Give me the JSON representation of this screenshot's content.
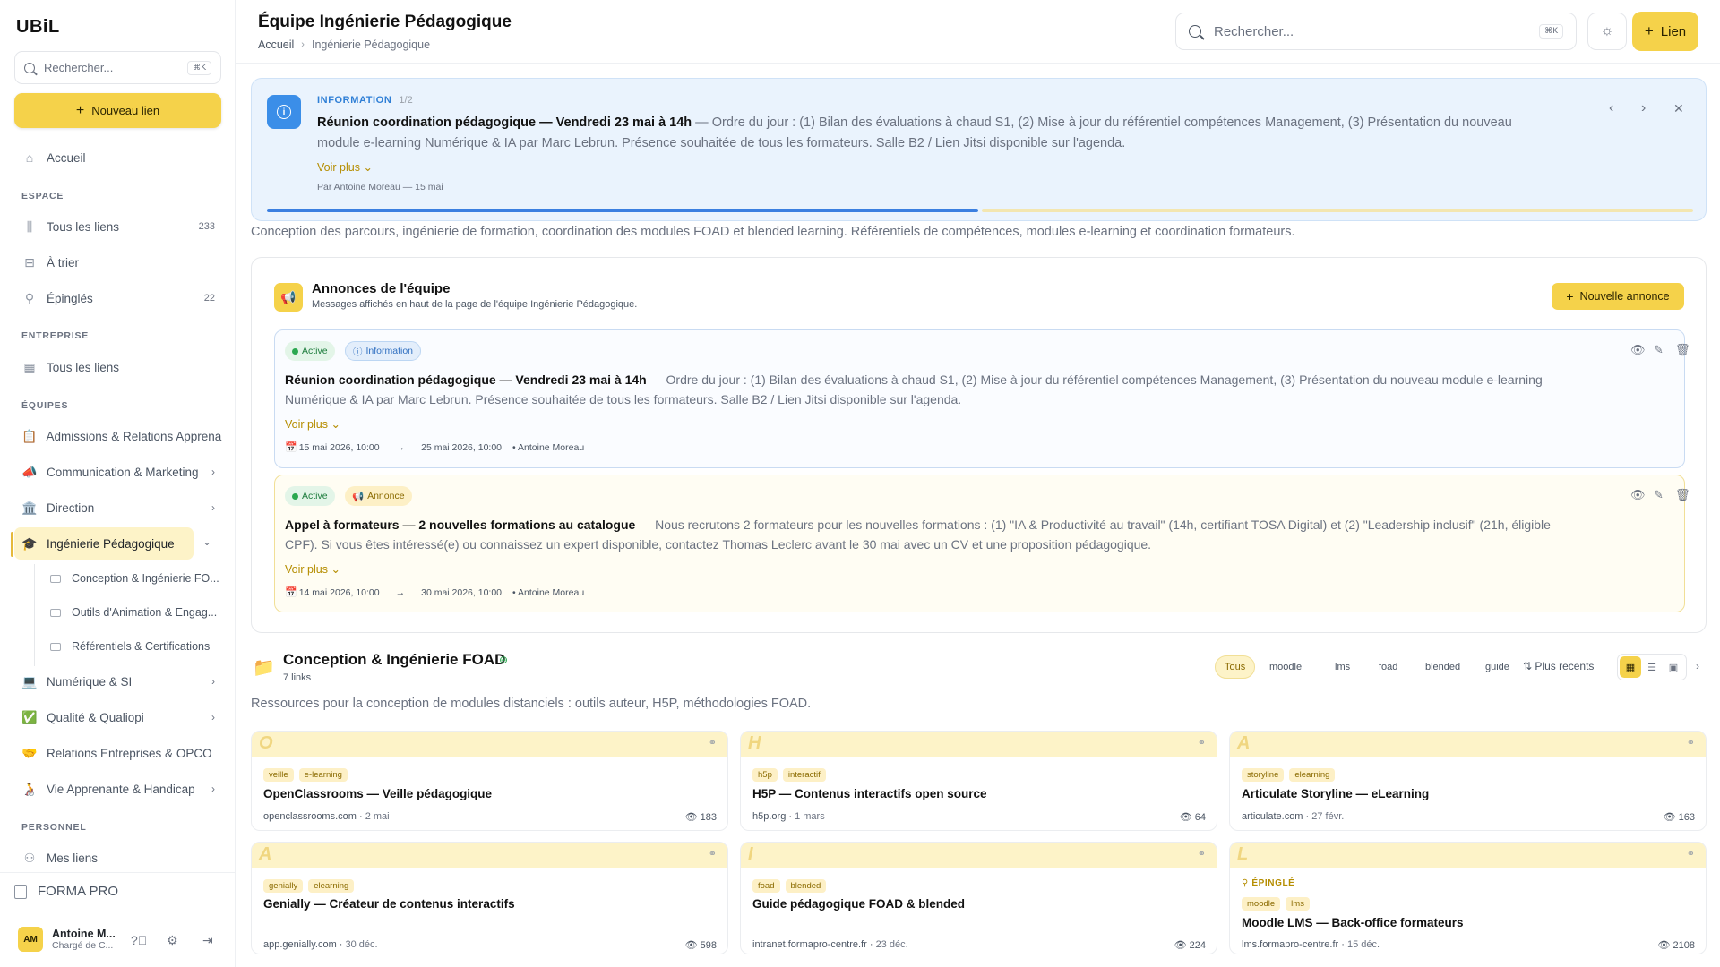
{
  "app": {
    "logo": "UBiL"
  },
  "sidebar": {
    "search_placeholder": "Rechercher...",
    "search_kbd": "⌘K",
    "new_link": "Nouveau lien",
    "home": "Accueil",
    "section_espace": "ESPACE",
    "all_links": "Tous les liens",
    "all_links_count": "233",
    "to_sort": "À trier",
    "pinned": "Épinglés",
    "pinned_count": "22",
    "section_entreprise": "ENTREPRISE",
    "ent_all_links": "Tous les liens",
    "section_equipes": "ÉQUIPES",
    "teams": [
      {
        "icon": "📋",
        "label": "Admissions & Relations Apprenants"
      },
      {
        "icon": "📣",
        "label": "Communication & Marketing"
      },
      {
        "icon": "🏛️",
        "label": "Direction"
      },
      {
        "icon": "🎓",
        "label": "Ingénierie Pédagogique"
      }
    ],
    "sub_items": [
      "Conception & Ingénierie FO...",
      "Outils d'Animation & Engag...",
      "Référentiels & Certifications"
    ],
    "teams2": [
      {
        "icon": "💻",
        "label": "Numérique & SI"
      },
      {
        "icon": "✅",
        "label": "Qualité & Qualiopi"
      },
      {
        "icon": "🤝",
        "label": "Relations Entreprises & OPCO"
      },
      {
        "icon": "🧑‍🦽",
        "label": "Vie Apprenante & Handicap"
      }
    ],
    "section_personnel": "PERSONNEL",
    "my_links": "Mes liens",
    "org_name": "FORMA PRO",
    "user": {
      "initials": "AM",
      "name": "Antoine M...",
      "role": "Chargé de C..."
    }
  },
  "header": {
    "title": "Équipe Ingénierie Pédagogique",
    "crumb_home": "Accueil",
    "crumb_current": "Ingénierie Pédagogique",
    "search_placeholder": "Rechercher...",
    "search_kbd": "⌘K",
    "link_button": "Lien"
  },
  "banner": {
    "label": "INFORMATION",
    "page": "1/2",
    "title": "Réunion coordination pédagogique — Vendredi 23 mai à 14h",
    "body": " — Ordre du jour : (1) Bilan des évaluations à chaud S1, (2) Mise à jour du référentiel compétences Management, (3) Présentation du nouveau module e-learning Numérique & IA par Marc Lebrun. Présence souhaitée de tous les formateurs. Salle B2 / Lien Jitsi disponible sur l'agenda.",
    "more": "Voir plus",
    "by": "Par Antoine Moreau — 15 mai"
  },
  "team_description": "Conception des parcours, ingénierie de formation, coordination des modules FOAD et blended learning. Référentiels de compétences, modules e-learning et coordination formateurs.",
  "announcements": {
    "title": "Annonces de l'équipe",
    "subtitle": "Messages affichés en haut de la page de l'équipe Ingénierie Pédagogique.",
    "new_button": "Nouvelle annonce",
    "items": [
      {
        "status": "Active",
        "type": "Information",
        "title": "Réunion coordination pédagogique — Vendredi 23 mai à 14h",
        "body": " — Ordre du jour : (1) Bilan des évaluations à chaud S1, (2) Mise à jour du référentiel compétences Management, (3) Présentation du nouveau module e-learning Numérique & IA par Marc Lebrun. Présence souhaitée de tous les formateurs. Salle B2 / Lien Jitsi disponible sur l'agenda.",
        "more": "Voir plus",
        "start": "15 mai 2026, 10:00",
        "end": "25 mai 2026, 10:00",
        "author": "• Antoine Moreau"
      },
      {
        "status": "Active",
        "type": "Annonce",
        "title": "Appel à formateurs — 2 nouvelles formations au catalogue",
        "body": " — Nous recrutons 2 formateurs pour les nouvelles formations : (1) \"IA & Productivité au travail\" (14h, certifiant TOSA Digital) et (2) \"Leadership inclusif\" (21h, éligible CPF). Si vous êtes intéressé(e) ou connaissez un expert disponible, contactez Thomas Leclerc avant le 30 mai avec un CV et une proposition pédagogique.",
        "more": "Voir plus",
        "start": "14 mai 2026, 10:00",
        "end": "30 mai 2026, 10:00",
        "author": "• Antoine Moreau"
      }
    ]
  },
  "section": {
    "icon": "📁",
    "title": "Conception & Ingénierie FOAD",
    "count": "7 links",
    "description": "Ressources pour la conception de modules distanciels : outils auteur, H5P, méthodologies FOAD.",
    "filters": [
      "Tous",
      "moodle",
      "lms",
      "foad",
      "blended",
      "guide"
    ],
    "sort": "Plus recents",
    "cards": [
      {
        "letter": "O",
        "tags": [
          "veille",
          "e-learning"
        ],
        "title": "OpenClassrooms — Veille pédagogique",
        "domain": "openclassrooms.com",
        "date": "2 mai",
        "views": "183"
      },
      {
        "letter": "H",
        "tags": [
          "h5p",
          "interactif"
        ],
        "title": "H5P — Contenus interactifs open source",
        "domain": "h5p.org",
        "date": "1 mars",
        "views": "64"
      },
      {
        "letter": "A",
        "tags": [
          "storyline",
          "elearning"
        ],
        "title": "Articulate Storyline — eLearning",
        "domain": "articulate.com",
        "date": "27 févr.",
        "views": "163"
      },
      {
        "letter": "A",
        "tags": [
          "genially",
          "elearning"
        ],
        "title": "Genially — Créateur de contenus interactifs",
        "domain": "app.genially.com",
        "date": "30 déc.",
        "views": "598"
      },
      {
        "letter": "I",
        "tags": [
          "foad",
          "blended"
        ],
        "title": "Guide pédagogique FOAD & blended",
        "domain": "intranet.formapro-centre.fr",
        "date": "23 déc.",
        "views": "224"
      },
      {
        "letter": "L",
        "pin": "ÉPINGLÉ",
        "tags": [
          "moodle",
          "lms"
        ],
        "title": "Moodle LMS — Back-office formateurs",
        "domain": "lms.formapro-centre.fr",
        "date": "15 déc.",
        "views": "2108"
      }
    ]
  }
}
